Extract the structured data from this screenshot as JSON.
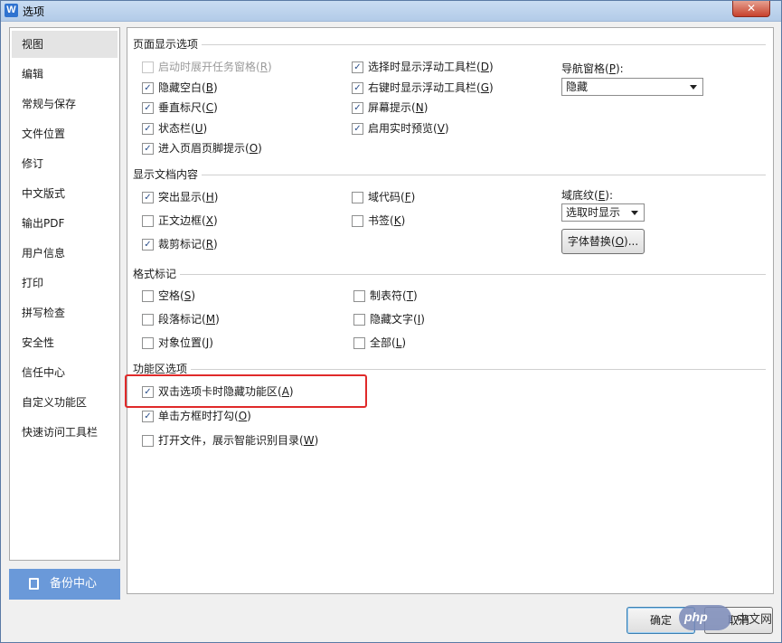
{
  "window": {
    "title": "选项",
    "app_icon_letter": "W",
    "close_symbol": "✕"
  },
  "sidebar": {
    "items": [
      {
        "label": "视图",
        "active": true
      },
      {
        "label": "编辑"
      },
      {
        "label": "常规与保存"
      },
      {
        "label": "文件位置"
      },
      {
        "label": "修订"
      },
      {
        "label": "中文版式"
      },
      {
        "label": "输出PDF"
      },
      {
        "label": "用户信息"
      },
      {
        "label": "打印"
      },
      {
        "label": "拼写检查"
      },
      {
        "label": "安全性"
      },
      {
        "label": "信任中心"
      },
      {
        "label": "自定义功能区"
      },
      {
        "label": "快速访问工具栏"
      }
    ],
    "backup_button": "备份中心"
  },
  "groups": {
    "page_display": "页面显示选项",
    "doc_content": "显示文档内容",
    "format_marks": "格式标记",
    "ribbon": "功能区选项"
  },
  "options": {
    "startup_task_pane": {
      "label": "启动时展开任务窗格",
      "key": "R",
      "checked": false,
      "disabled": true
    },
    "hide_whitespace": {
      "label": "隐藏空白",
      "key": "B",
      "checked": true
    },
    "vertical_ruler": {
      "label": "垂直标尺",
      "key": "C",
      "checked": true
    },
    "status_bar": {
      "label": "状态栏",
      "key": "U",
      "checked": true
    },
    "header_footer_tip": {
      "label": "进入页眉页脚提示",
      "key": "O",
      "checked": true
    },
    "float_toolbar_select": {
      "label": "选择时显示浮动工具栏",
      "key": "D",
      "checked": true
    },
    "float_toolbar_rightclick": {
      "label": "右键时显示浮动工具栏",
      "key": "G",
      "checked": true
    },
    "screen_tips": {
      "label": "屏幕提示",
      "key": "N",
      "checked": true
    },
    "live_preview": {
      "label": "启用实时预览",
      "key": "V",
      "checked": true
    },
    "highlight": {
      "label": "突出显示",
      "key": "H",
      "checked": true
    },
    "text_boundaries": {
      "label": "正文边框",
      "key": "X",
      "checked": false
    },
    "crop_marks": {
      "label": "裁剪标记",
      "key": "R",
      "checked": true
    },
    "field_codes": {
      "label": "域代码",
      "key": "F",
      "checked": false
    },
    "bookmarks": {
      "label": "书签",
      "key": "K",
      "checked": false
    },
    "spaces": {
      "label": "空格",
      "key": "S",
      "checked": false
    },
    "paragraph_marks": {
      "label": "段落标记",
      "key": "M",
      "checked": false
    },
    "object_anchors": {
      "label": "对象位置",
      "key": "J",
      "checked": false
    },
    "tab_chars": {
      "label": "制表符",
      "key": "T",
      "checked": false
    },
    "hidden_text": {
      "label": "隐藏文字",
      "key": "I",
      "checked": false
    },
    "all_marks": {
      "label": "全部",
      "key": "L",
      "checked": false
    },
    "dblclick_hide_ribbon": {
      "label": "双击选项卡时隐藏功能区",
      "key": "A",
      "checked": true
    },
    "click_box_check": {
      "label": "单击方框时打勾",
      "key": "O",
      "checked": true
    },
    "smart_toc": {
      "label": "打开文件，展示智能识别目录",
      "key": "W",
      "checked": false
    }
  },
  "nav_pane": {
    "label": "导航窗格",
    "key": "P",
    "value": "隐藏"
  },
  "field_shading": {
    "label": "域底纹",
    "key": "E",
    "value": "选取时显示"
  },
  "font_substitution_button": {
    "label": "字体替换",
    "key": "O"
  },
  "footer": {
    "ok": "确定",
    "cancel": "取消"
  },
  "watermark": {
    "logo": "php",
    "text": "中文网"
  },
  "colors": {
    "highlight_border": "#e02a2a",
    "backup_button": "#6a99d9",
    "check": "#2b4f8a"
  }
}
